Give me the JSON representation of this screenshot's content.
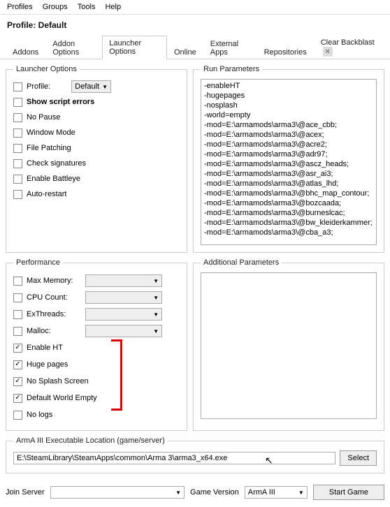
{
  "menu": {
    "profiles": "Profiles",
    "groups": "Groups",
    "tools": "Tools",
    "help": "Help"
  },
  "title": "Profile: Default",
  "tabs": {
    "addons": "Addons",
    "addon_options": "Addon Options",
    "launcher_options": "Launcher Options",
    "online": "Online",
    "external_apps": "External Apps",
    "repositories": "Repositories",
    "clear_backblast": "Clear Backblast"
  },
  "launcher_options": {
    "legend": "Launcher Options",
    "profile": "Profile:",
    "profile_value": "Default",
    "show_script_errors": "Show script errors",
    "no_pause": "No Pause",
    "window_mode": "Window Mode",
    "file_patching": "File Patching",
    "check_signatures": "Check signatures",
    "enable_battleye": "Enable Battleye",
    "auto_restart": "Auto-restart"
  },
  "run_params": {
    "legend": "Run Parameters",
    "text": "-enableHT\n-hugepages\n-nosplash\n-world=empty\n-mod=E:\\armamods\\arma3\\@ace_cbb;\n-mod=E:\\armamods\\arma3\\@acex;\n-mod=E:\\armamods\\arma3\\@acre2;\n-mod=E:\\armamods\\arma3\\@adr97;\n-mod=E:\\armamods\\arma3\\@ascz_heads;\n-mod=E:\\armamods\\arma3\\@asr_ai3;\n-mod=E:\\armamods\\arma3\\@atlas_lhd;\n-mod=E:\\armamods\\arma3\\@bhc_map_contour;\n-mod=E:\\armamods\\arma3\\@bozcaada;\n-mod=E:\\armamods\\arma3\\@burneslcac;\n-mod=E:\\armamods\\arma3\\@bw_kleiderkammer;\n-mod=E:\\armamods\\arma3\\@cba_a3;"
  },
  "performance": {
    "legend": "Performance",
    "max_memory": "Max Memory:",
    "cpu_count": "CPU Count:",
    "exthreads": "ExThreads:",
    "malloc": "Malloc:",
    "enable_ht": "Enable HT",
    "huge_pages": "Huge pages",
    "no_splash": "No Splash Screen",
    "default_world_empty": "Default World Empty",
    "no_logs": "No logs"
  },
  "additional": {
    "legend": "Additional Parameters",
    "value": ""
  },
  "exe": {
    "legend": "ArmA III Executable Location (game/server)",
    "path": "E:\\SteamLibrary\\SteamApps\\common\\Arma 3\\arma3_x64.exe",
    "select": "Select"
  },
  "footer": {
    "join_server": "Join Server",
    "game_version": "Game Version",
    "game_version_value": "ArmA III",
    "start_game": "Start Game"
  }
}
